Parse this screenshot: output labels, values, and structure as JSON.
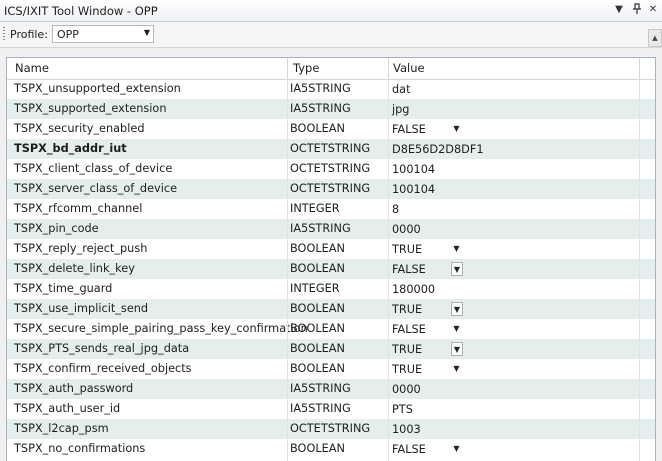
{
  "window": {
    "title": "ICS/IXIT Tool Window - OPP",
    "dropdown_glyph": "▼",
    "pin_glyph": "ㅁ",
    "close_glyph": "✕"
  },
  "toolbar": {
    "profile_label": "Profile:",
    "profile_value": "OPP",
    "profile_options_selected": "OPP"
  },
  "table": {
    "headers": {
      "name": "Name",
      "type": "Type",
      "value": "Value"
    },
    "rows": [
      {
        "name": "TSPX_unsupported_extension",
        "type": "IA5STRING",
        "value": "dat",
        "dropdown": "none",
        "bold": false
      },
      {
        "name": "TSPX_supported_extension",
        "type": "IA5STRING",
        "value": "jpg",
        "dropdown": "none",
        "bold": false
      },
      {
        "name": "TSPX_security_enabled",
        "type": "BOOLEAN",
        "value": "FALSE",
        "dropdown": "arrow",
        "bold": false
      },
      {
        "name": "TSPX_bd_addr_iut",
        "type": "OCTETSTRING",
        "value": "D8E56D2D8DF1",
        "dropdown": "none",
        "bold": true
      },
      {
        "name": "TSPX_client_class_of_device",
        "type": "OCTETSTRING",
        "value": "100104",
        "dropdown": "none",
        "bold": false
      },
      {
        "name": "TSPX_server_class_of_device",
        "type": "OCTETSTRING",
        "value": "100104",
        "dropdown": "none",
        "bold": false
      },
      {
        "name": "TSPX_rfcomm_channel",
        "type": "INTEGER",
        "value": "8",
        "dropdown": "none",
        "bold": false
      },
      {
        "name": "TSPX_pin_code",
        "type": "IA5STRING",
        "value": "0000",
        "dropdown": "none",
        "bold": false
      },
      {
        "name": "TSPX_reply_reject_push",
        "type": "BOOLEAN",
        "value": "TRUE",
        "dropdown": "arrow",
        "bold": false
      },
      {
        "name": "TSPX_delete_link_key",
        "type": "BOOLEAN",
        "value": "FALSE",
        "dropdown": "box",
        "bold": false
      },
      {
        "name": "TSPX_time_guard",
        "type": "INTEGER",
        "value": "180000",
        "dropdown": "none",
        "bold": false
      },
      {
        "name": "TSPX_use_implicit_send",
        "type": "BOOLEAN",
        "value": "TRUE",
        "dropdown": "box",
        "bold": false
      },
      {
        "name": "TSPX_secure_simple_pairing_pass_key_confirmation",
        "type": "BOOLEAN",
        "value": "FALSE",
        "dropdown": "arrow",
        "bold": false
      },
      {
        "name": "TSPX_PTS_sends_real_jpg_data",
        "type": "BOOLEAN",
        "value": "TRUE",
        "dropdown": "box",
        "bold": false
      },
      {
        "name": "TSPX_confirm_received_objects",
        "type": "BOOLEAN",
        "value": "TRUE",
        "dropdown": "arrow",
        "bold": false
      },
      {
        "name": "TSPX_auth_password",
        "type": "IA5STRING",
        "value": "0000",
        "dropdown": "none",
        "bold": false
      },
      {
        "name": "TSPX_auth_user_id",
        "type": "IA5STRING",
        "value": "PTS",
        "dropdown": "none",
        "bold": false
      },
      {
        "name": "TSPX_l2cap_psm",
        "type": "OCTETSTRING",
        "value": "1003",
        "dropdown": "none",
        "bold": false
      },
      {
        "name": "TSPX_no_confirmations",
        "type": "BOOLEAN",
        "value": "FALSE",
        "dropdown": "arrow",
        "bold": false
      }
    ]
  },
  "colors": {
    "alt_row": "#e4eeec",
    "grid_border": "#a7b2c0",
    "background": "#f0f0f0"
  }
}
